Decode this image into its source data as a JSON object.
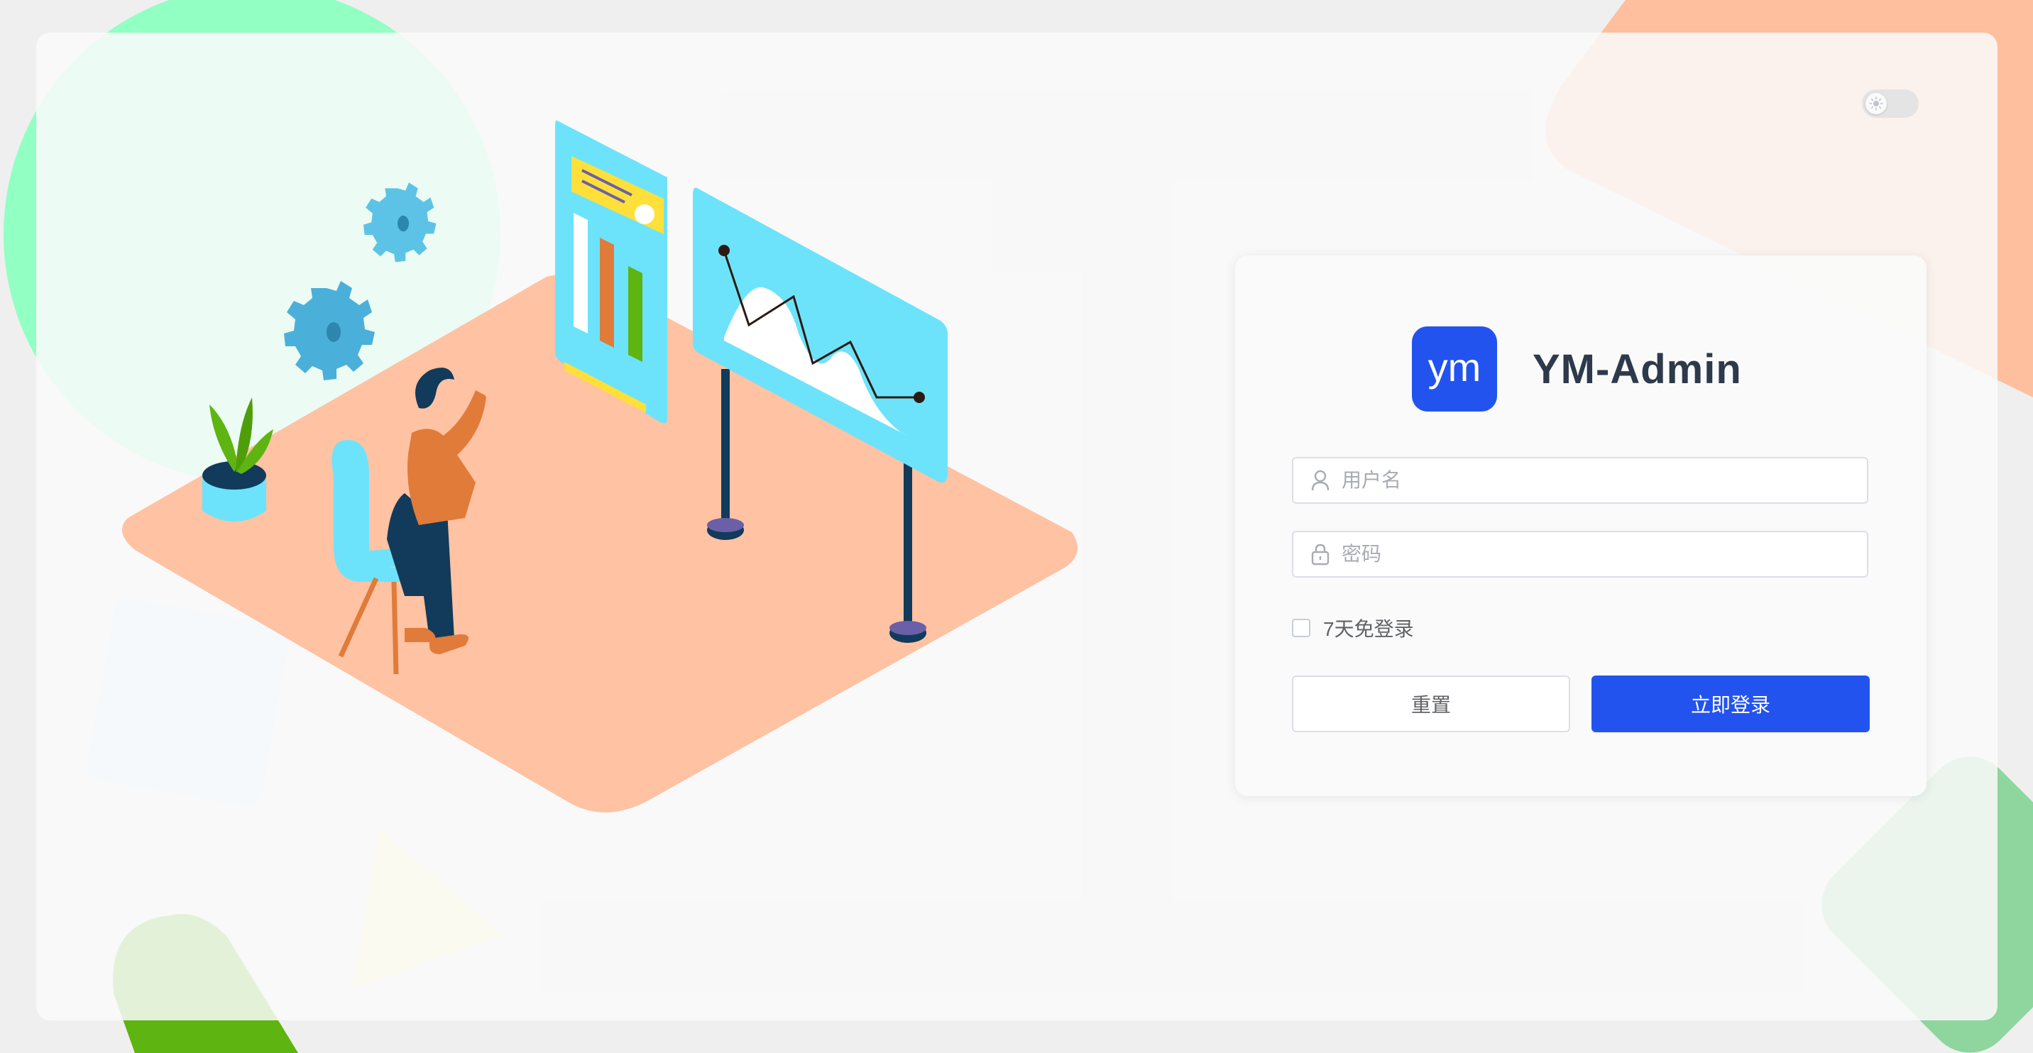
{
  "app": {
    "title": "YM-Admin",
    "logo_text": "ym"
  },
  "theme_toggle": {
    "icon": "sun-icon",
    "state": "light"
  },
  "login": {
    "username_placeholder": "用户名",
    "password_placeholder": "密码",
    "username_value": "",
    "password_value": "",
    "remember_label": "7天免登录",
    "remember_checked": false,
    "reset_label": "重置",
    "submit_label": "立即登录"
  },
  "colors": {
    "primary": "#2353ef",
    "title_text": "#2d3a4b",
    "floor": "#ffc2a3",
    "screen": "#6ce3fb"
  },
  "icons": {
    "username": "user-icon",
    "password": "lock-icon",
    "theme": "sun-icon"
  }
}
